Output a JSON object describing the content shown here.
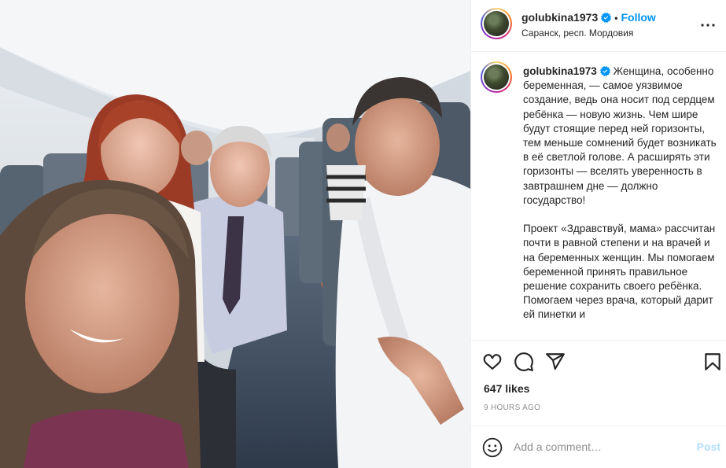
{
  "post": {
    "username": "golubkina1973",
    "follow_label": "Follow",
    "dot_separator": "•",
    "location": "Саранск, респ. Мордовия",
    "caption_paragraph_1": "Женщина, особенно беременная, — самое уязвимое создание, ведь она носит под сердцем ребёнка — новую жизнь. Чем шире будут стоящие перед ней горизонты, тем меньше сомнений будет возникать в её светлой голове. А расширять эти горизонты — вселять уверенность в завтрашнем дне — должно государство!",
    "caption_paragraph_2": "Проект «Здравствуй, мама» рассчитан почти в равной степени и на врачей и на беременных женщин. Мы помогаем беременной принять правильное решение сохранить своего ребёнка. Помогаем через врача, который дарит ей пинетки и",
    "likes": "647 likes",
    "timestamp": "9 HOURS AGO",
    "comment_placeholder": "Add a comment…",
    "post_label": "Post"
  },
  "icons": {
    "verified": "verified-badge-icon",
    "more": "more-options-icon",
    "like": "heart-icon",
    "comment": "comment-icon",
    "share": "share-icon",
    "save": "bookmark-icon",
    "emoji": "emoji-icon"
  },
  "colors": {
    "accent": "#0095f6",
    "post_disabled": "#b2dffc",
    "muted": "#8e8e8e",
    "border": "#efefef",
    "text": "#262626"
  }
}
